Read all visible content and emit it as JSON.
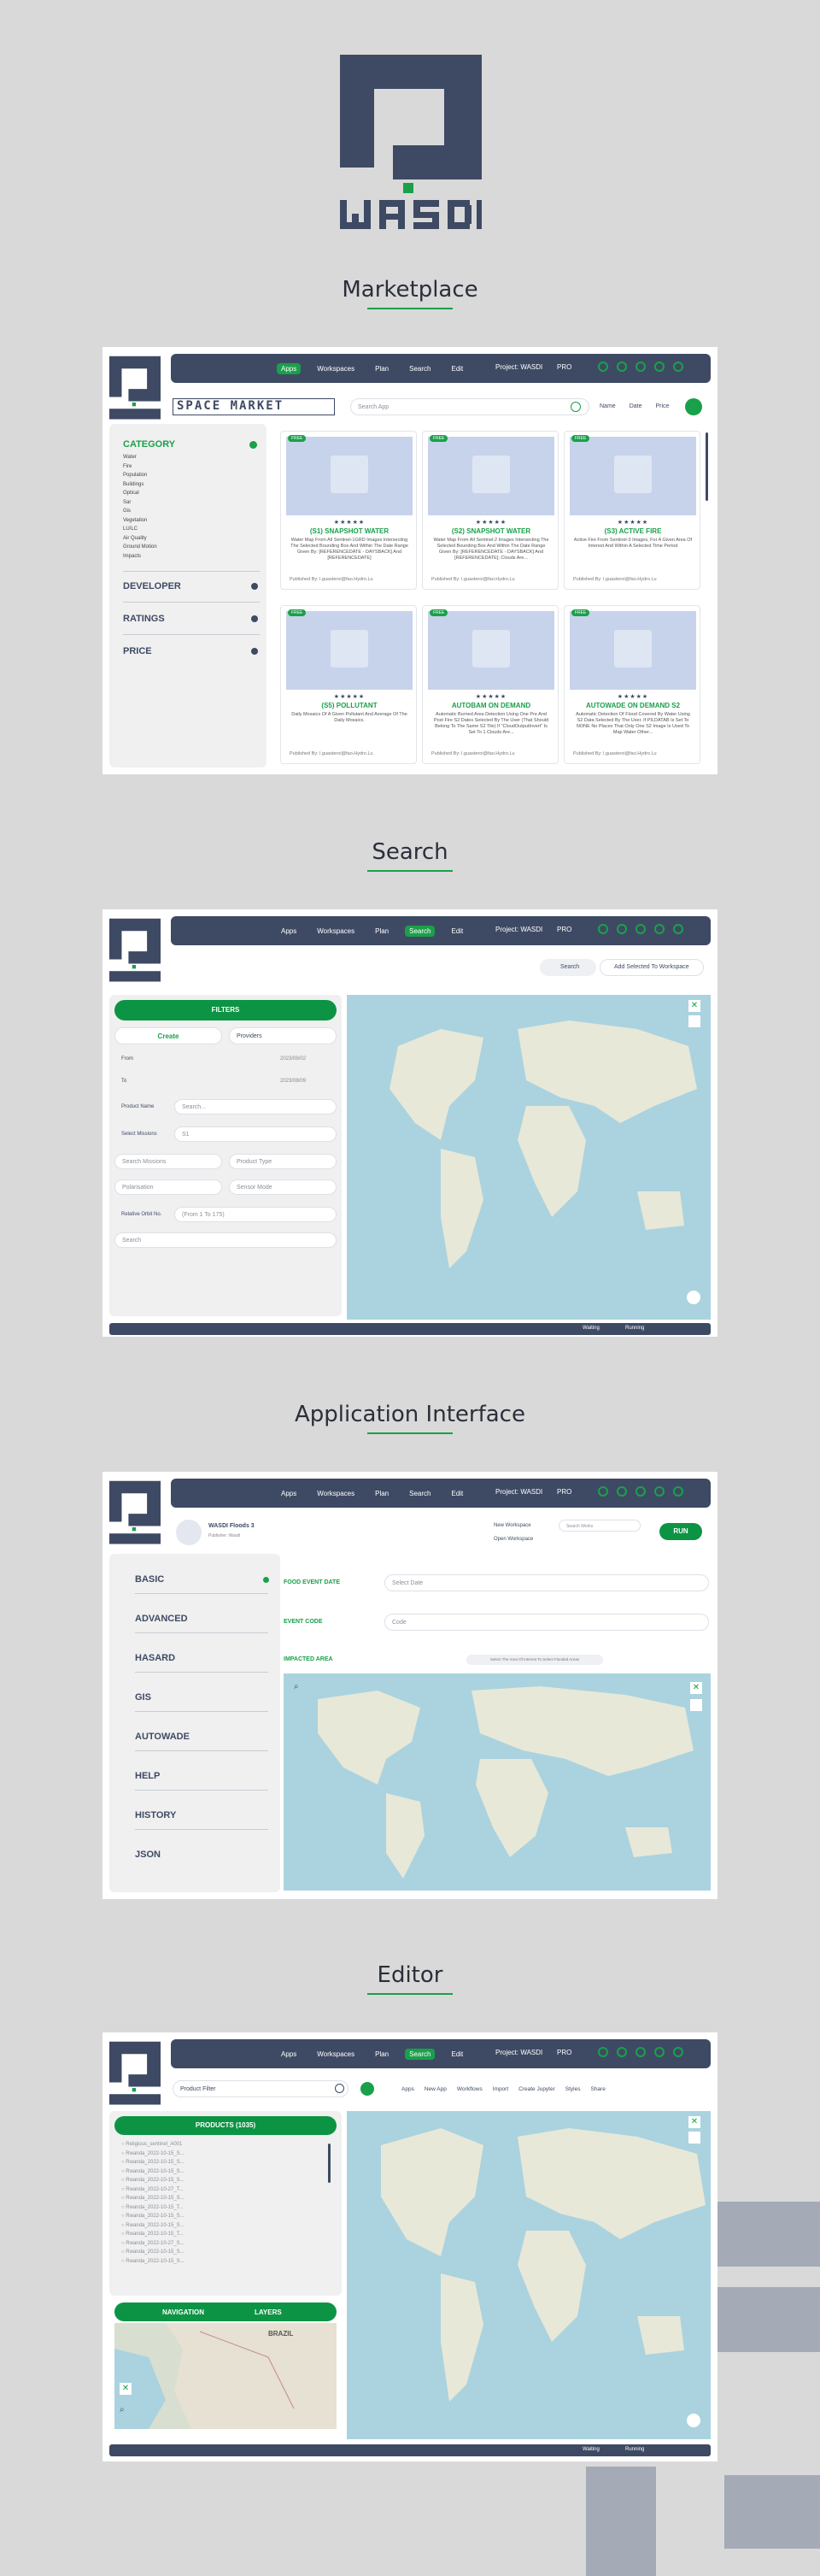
{
  "sections": {
    "marketplace": "Marketplace",
    "search": "Search",
    "app_interface": "Application Interface",
    "editor": "Editor"
  },
  "brand": {
    "name": "WASDI",
    "color": "#3e4a64",
    "accent": "#1aa04a"
  },
  "nav": {
    "apps": "Apps",
    "workspaces": "Workspaces",
    "plan": "Plan",
    "search": "Search",
    "edit": "Edit",
    "project": "Project: WASDI",
    "pro": "PRO"
  },
  "marketplace": {
    "banner": "SPACE MARKET",
    "search_placeholder": "Search App",
    "sort": [
      "Name",
      "Date",
      "Price"
    ],
    "category_title": "CATEGORY",
    "categories": [
      "Water",
      "Fire",
      "Population",
      "Buildings",
      "Optical",
      "Sar",
      "Gis",
      "Vegetation",
      "LU/LC",
      "Air Quality",
      "Ground Motion",
      "Impacts"
    ],
    "filters": [
      "DEVELOPER",
      "RATINGS",
      "PRICE"
    ],
    "cards": [
      {
        "badge": "FREE",
        "stars": "★★★★★",
        "title": "(S1) SNAPSHOT WATER",
        "desc": "Water Map From All Sentinel-1GRD Images Intersecting The Selected Bounding Box And Within The Date Range Given By: [REFERENCEDATE - DAYSBACK] And [REFERENCEDATE]",
        "pub": "Published By: l.guasteroi@fao.Hydro.Lu"
      },
      {
        "badge": "FREE",
        "stars": "★★★★★",
        "title": "(S2) SNAPSHOT WATER",
        "desc": "Water Map From All Sentinel-2 Images Intersecting The Selected Bounding Box And Within The Date Range Given By: [REFERENCEDATE - DAYSBACK] And [REFERENCEDATE]; Clouds Are...",
        "pub": "Published By: l.guasteroi@fao.Hydro.Lu"
      },
      {
        "badge": "FREE",
        "stars": "★★★★★",
        "title": "(S3) ACTIVE FIRE",
        "desc": "Active Fire From Sentinel-3 Images, For A Given Area Of Interest And Within A Selected Time Period",
        "pub": "Published By: l.guasteroi@fao.Hydro.Lu"
      },
      {
        "badge": "FREE",
        "stars": "★★★★★",
        "title": "(S5) POLLUTANT",
        "desc": "Daily Mosaics Of A Given Pollutant And Average Of The Daily Mosaics.",
        "pub": "Published By: l.guasteroi@fao.Hydro.Lu"
      },
      {
        "badge": "FREE",
        "stars": "★★★★★",
        "title": "AUTOBAM ON DEMAND",
        "desc": "Automatic Burned Area Detection Using One Pre And Post Fire S2 Dates Selected By The User (That Should Belong To The Same S2 Tile) If \"CloudOutputInvert\" Is Set To 1 Clouds Are...",
        "pub": "Published By: l.guasteroi@fao.Hydro.Lu"
      },
      {
        "badge": "FREE",
        "stars": "★★★★★",
        "title": "AUTOWADE ON DEMAND S2",
        "desc": "Automatic Detection Of Flood Covered By Water Using S2 Data Selected By The User. If PILDATAB Is Set To NONE No Places That Only One S2 Image Is Used To Map Water Other...",
        "pub": "Published By: l.guasteroi@fao.Hydro.Lu"
      }
    ]
  },
  "search": {
    "search_btn": "Search",
    "add_btn": "Add Selected To Workspace",
    "filters_title": "FILTERS",
    "tab_create": "Create",
    "tab_providers": "Providers",
    "from_label": "From",
    "from_value": "2023/08/02",
    "to_label": "To",
    "to_value": "2023/08/09",
    "product_name_label": "Product Name",
    "product_name_placeholder": "Search...",
    "missions_label": "Select Missions",
    "missions_value": "S1",
    "search_missions": "Search Missions",
    "product_type": "Product Type",
    "polarisation": "Polarisation",
    "sensor_mode": "Sensor Mode",
    "relative_orbit_label": "Relative Orbit No.",
    "relative_orbit_placeholder": "(From 1 To 175)",
    "search_field": "Search",
    "status_waiting": "Waiting",
    "status_running": "Running"
  },
  "appui": {
    "app_name": "WASDI Floods 3",
    "app_sub": "Publisher: Wasdi",
    "new_ws": "New Workspace",
    "open_ws": "Open Workspace",
    "ws_placeholder": "Search Works",
    "run": "RUN",
    "menu": [
      "BASIC",
      "ADVANCED",
      "HASARD",
      "GIS",
      "AUTOWADE",
      "HELP",
      "HISTORY",
      "JSON"
    ],
    "food_event_date": "FOOD EVENT DATE",
    "date_placeholder": "Select Date",
    "event_code": "EVENT CODE",
    "code_placeholder": "Code",
    "impacted_area": "IMPACTED AREA",
    "impacted_hint": "Select The Area Of Interest To Select Flooded Areas"
  },
  "editor": {
    "filter_placeholder": "Product Filter",
    "toolbar": [
      "Apps",
      "New App",
      "Workflows",
      "Import",
      "Create Jupyter",
      "Styles",
      "Share"
    ],
    "products_title": "PRODUCTS",
    "products_count": "(1035)",
    "products": [
      "Religious_sentinel_A001",
      "Rwanda_2022-10-15_S...",
      "Rwanda_2022-10-15_S...",
      "Rwanda_2022-10-15_S...",
      "Rwanda_2022-10-15_S...",
      "Rwanda_2022-10-27_T...",
      "Rwanda_2022-10-15_S...",
      "Rwanda_2022-10-15_T...",
      "Rwanda_2022-10-15_S...",
      "Rwanda_2022-10-15_S...",
      "Rwanda_2022-10-15_T...",
      "Rwanda_2022-10-27_S...",
      "Rwanda_2022-10-15_S...",
      "Rwanda_2022-10-15_S..."
    ],
    "tab_nav": "NAVIGATION",
    "tab_layers": "LAYERS",
    "minimap_label": "BRAZIL"
  }
}
